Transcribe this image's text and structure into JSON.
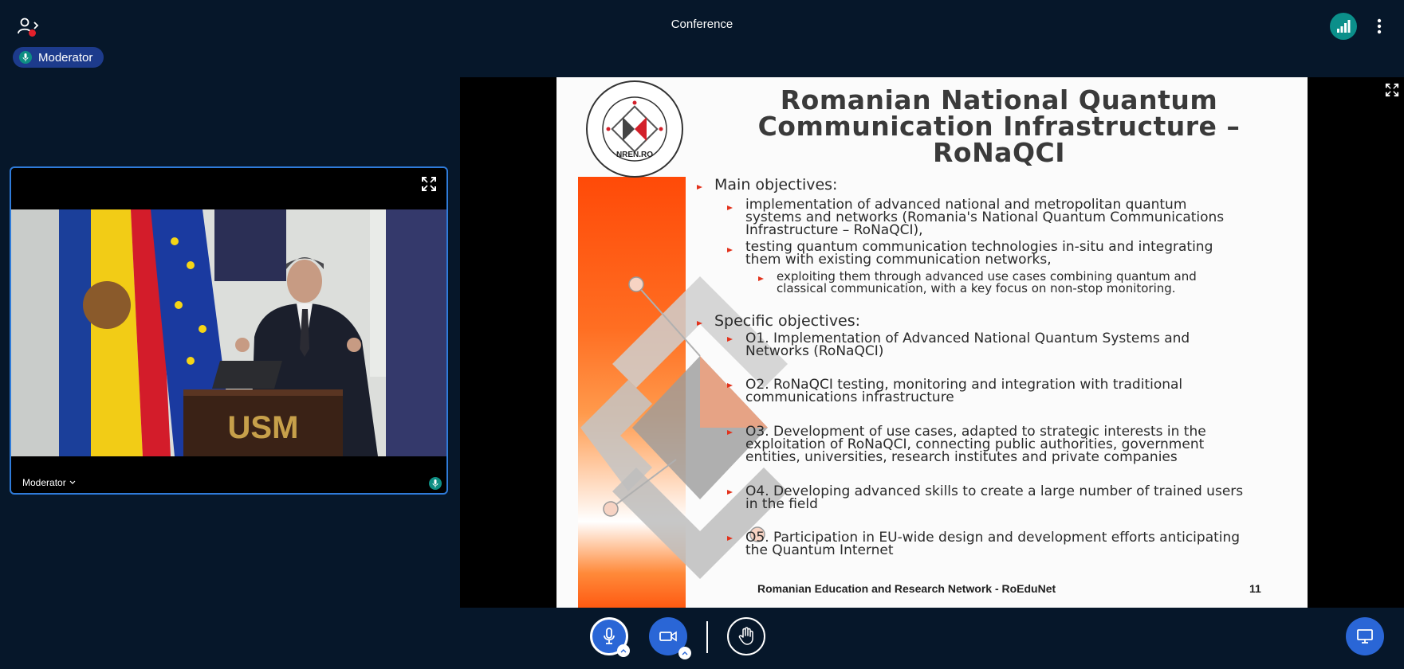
{
  "app": {
    "title": "Conference"
  },
  "header": {
    "moderator_badge": "Moderator"
  },
  "webcam": {
    "participant_name": "Moderator",
    "podium_text": "USM"
  },
  "slide": {
    "title_lines": [
      "Romanian National Quantum",
      "Communication Infrastructure –",
      "RoNaQCI"
    ],
    "logo_text": "NREN.RO",
    "main_objectives_heading": "Main objectives:",
    "main_objectives": [
      "implementation of advanced national and metropolitan quantum\nsystems and networks (Romania's National Quantum Communications\nInfrastructure – RoNaQCI),",
      "testing quantum communication technologies in-situ and integrating\nthem with existing communication networks,"
    ],
    "main_sub_objective": "exploiting them through advanced use cases combining quantum and\nclassical communication, with a key focus on non-stop monitoring.",
    "specific_objectives_heading": "Specific objectives:",
    "specific_objectives": [
      "O1. Implementation of Advanced National Quantum Systems and\nNetworks (RoNaQCI)",
      "O2. RoNaQCI testing, monitoring and integration with traditional\ncommunications infrastructure",
      "O3. Development of use cases, adapted to strategic interests in the\nexploitation of RoNaQCI, connecting public authorities, government\nentities, universities, research institutes and private companies",
      "O4. Developing advanced skills to create a large number of trained users\nin the field",
      "O5. Participation in EU-wide design and development efforts anticipating\nthe Quantum Internet"
    ],
    "footer": "Romanian Education and Research Network - RoEduNet",
    "page_number": "11"
  },
  "icons": {
    "users": "users-toggle-icon",
    "connection": "connection-status-icon",
    "more": "more-options-icon",
    "fullscreen": "fullscreen-icon",
    "microphone": "microphone-icon",
    "camera": "camera-icon",
    "hand": "raise-hand-icon",
    "screen": "screen-share-icon"
  },
  "colors": {
    "background": "#06172a",
    "badge": "#1d3b8c",
    "accent_blue": "#2a66d6",
    "talking_green": "#0e8e83",
    "alert_red": "#e2202b",
    "slide_orange": "#ff5a12"
  }
}
